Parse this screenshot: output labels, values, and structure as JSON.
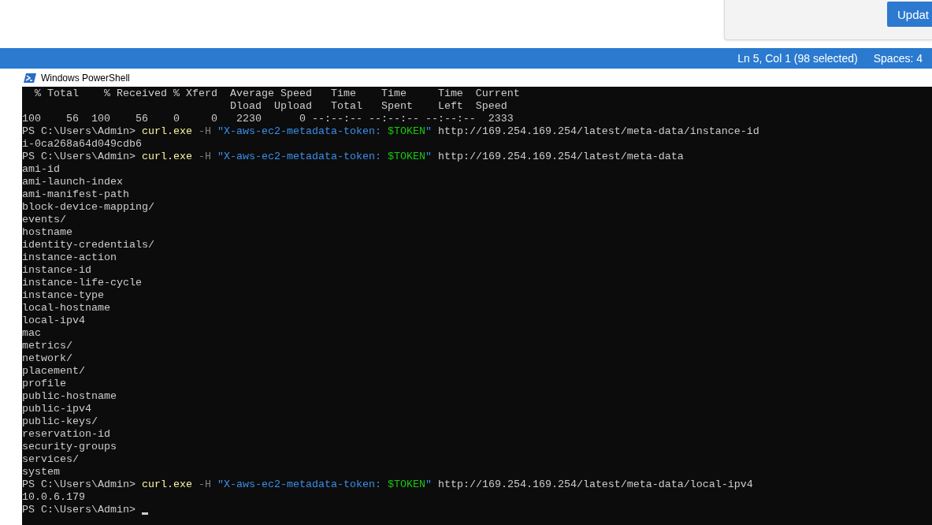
{
  "notification": {
    "button": "Updat"
  },
  "status_bar": {
    "position": "Ln 5, Col 1 (98 selected)",
    "indent": "Spaces: 4"
  },
  "window": {
    "title": "Windows PowerShell"
  },
  "terminal": {
    "lines": [
      {
        "kind": "output",
        "text": "  % Total    % Received % Xferd  Average Speed   Time    Time     Time  Current"
      },
      {
        "kind": "output",
        "text": "                                 Dload  Upload   Total   Spent    Left  Speed"
      },
      {
        "kind": "output",
        "text": "100    56  100    56    0     0   2230      0 --:--:-- --:--:-- --:--:--  2333"
      },
      {
        "kind": "command",
        "prompt": "PS C:\\Users\\Admin>",
        "command": "curl.exe",
        "parameter": "-H",
        "string_start": "\"X-aws-ec2-metadata-token: ",
        "variable": "$TOKEN",
        "string_end": "\"",
        "argument": "http://169.254.169.254/latest/meta-data/instance-id"
      },
      {
        "kind": "output",
        "text": "i-0ca268a64d049cdb6"
      },
      {
        "kind": "command",
        "prompt": "PS C:\\Users\\Admin>",
        "command": "curl.exe",
        "parameter": "-H",
        "string_start": "\"X-aws-ec2-metadata-token: ",
        "variable": "$TOKEN",
        "string_end": "\"",
        "argument": "http://169.254.169.254/latest/meta-data"
      },
      {
        "kind": "output",
        "text": "ami-id"
      },
      {
        "kind": "output",
        "text": "ami-launch-index"
      },
      {
        "kind": "output",
        "text": "ami-manifest-path"
      },
      {
        "kind": "output",
        "text": "block-device-mapping/"
      },
      {
        "kind": "output",
        "text": "events/"
      },
      {
        "kind": "output",
        "text": "hostname"
      },
      {
        "kind": "output",
        "text": "identity-credentials/"
      },
      {
        "kind": "output",
        "text": "instance-action"
      },
      {
        "kind": "output",
        "text": "instance-id"
      },
      {
        "kind": "output",
        "text": "instance-life-cycle"
      },
      {
        "kind": "output",
        "text": "instance-type"
      },
      {
        "kind": "output",
        "text": "local-hostname"
      },
      {
        "kind": "output",
        "text": "local-ipv4"
      },
      {
        "kind": "output",
        "text": "mac"
      },
      {
        "kind": "output",
        "text": "metrics/"
      },
      {
        "kind": "output",
        "text": "network/"
      },
      {
        "kind": "output",
        "text": "placement/"
      },
      {
        "kind": "output",
        "text": "profile"
      },
      {
        "kind": "output",
        "text": "public-hostname"
      },
      {
        "kind": "output",
        "text": "public-ipv4"
      },
      {
        "kind": "output",
        "text": "public-keys/"
      },
      {
        "kind": "output",
        "text": "reservation-id"
      },
      {
        "kind": "output",
        "text": "security-groups"
      },
      {
        "kind": "output",
        "text": "services/"
      },
      {
        "kind": "output",
        "text": "system"
      },
      {
        "kind": "command",
        "prompt": "PS C:\\Users\\Admin>",
        "command": "curl.exe",
        "parameter": "-H",
        "string_start": "\"X-aws-ec2-metadata-token: ",
        "variable": "$TOKEN",
        "string_end": "\"",
        "argument": "http://169.254.169.254/latest/meta-data/local-ipv4"
      },
      {
        "kind": "output",
        "text": "10.0.6.179"
      },
      {
        "kind": "prompt",
        "prompt": "PS C:\\Users\\Admin>",
        "cursor": true
      }
    ]
  }
}
